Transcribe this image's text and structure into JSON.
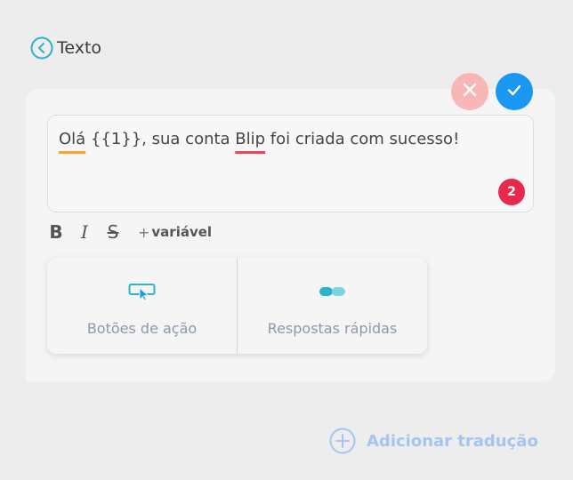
{
  "header": {
    "back_label": "Texto"
  },
  "editor": {
    "segments": [
      {
        "text": "Olá",
        "mark": "warn"
      },
      {
        "text": " {{1}}, sua conta ",
        "mark": ""
      },
      {
        "text": "Blip",
        "mark": "error"
      },
      {
        "text": " foi criada com sucesso!",
        "mark": ""
      }
    ],
    "error_count": "2"
  },
  "toolbar": {
    "bold": "B",
    "italic": "I",
    "strike": "S",
    "variable_plus": "+",
    "variable_label": "variável"
  },
  "options": [
    {
      "label": "Botões de ação",
      "icon": "cursor-click-icon"
    },
    {
      "label": "Respostas rápidas",
      "icon": "quick-replies-icon"
    }
  ],
  "footer": {
    "add_translation_label": "Adicionar tradução"
  },
  "colors": {
    "accent": "#1a97f0",
    "teal": "#2bb5c8",
    "cancel": "#f9b6b6",
    "error": "#e8294e",
    "warn_underline": "#f5a623",
    "error_underline": "#e8475a",
    "link_light": "#a5c4f0"
  }
}
